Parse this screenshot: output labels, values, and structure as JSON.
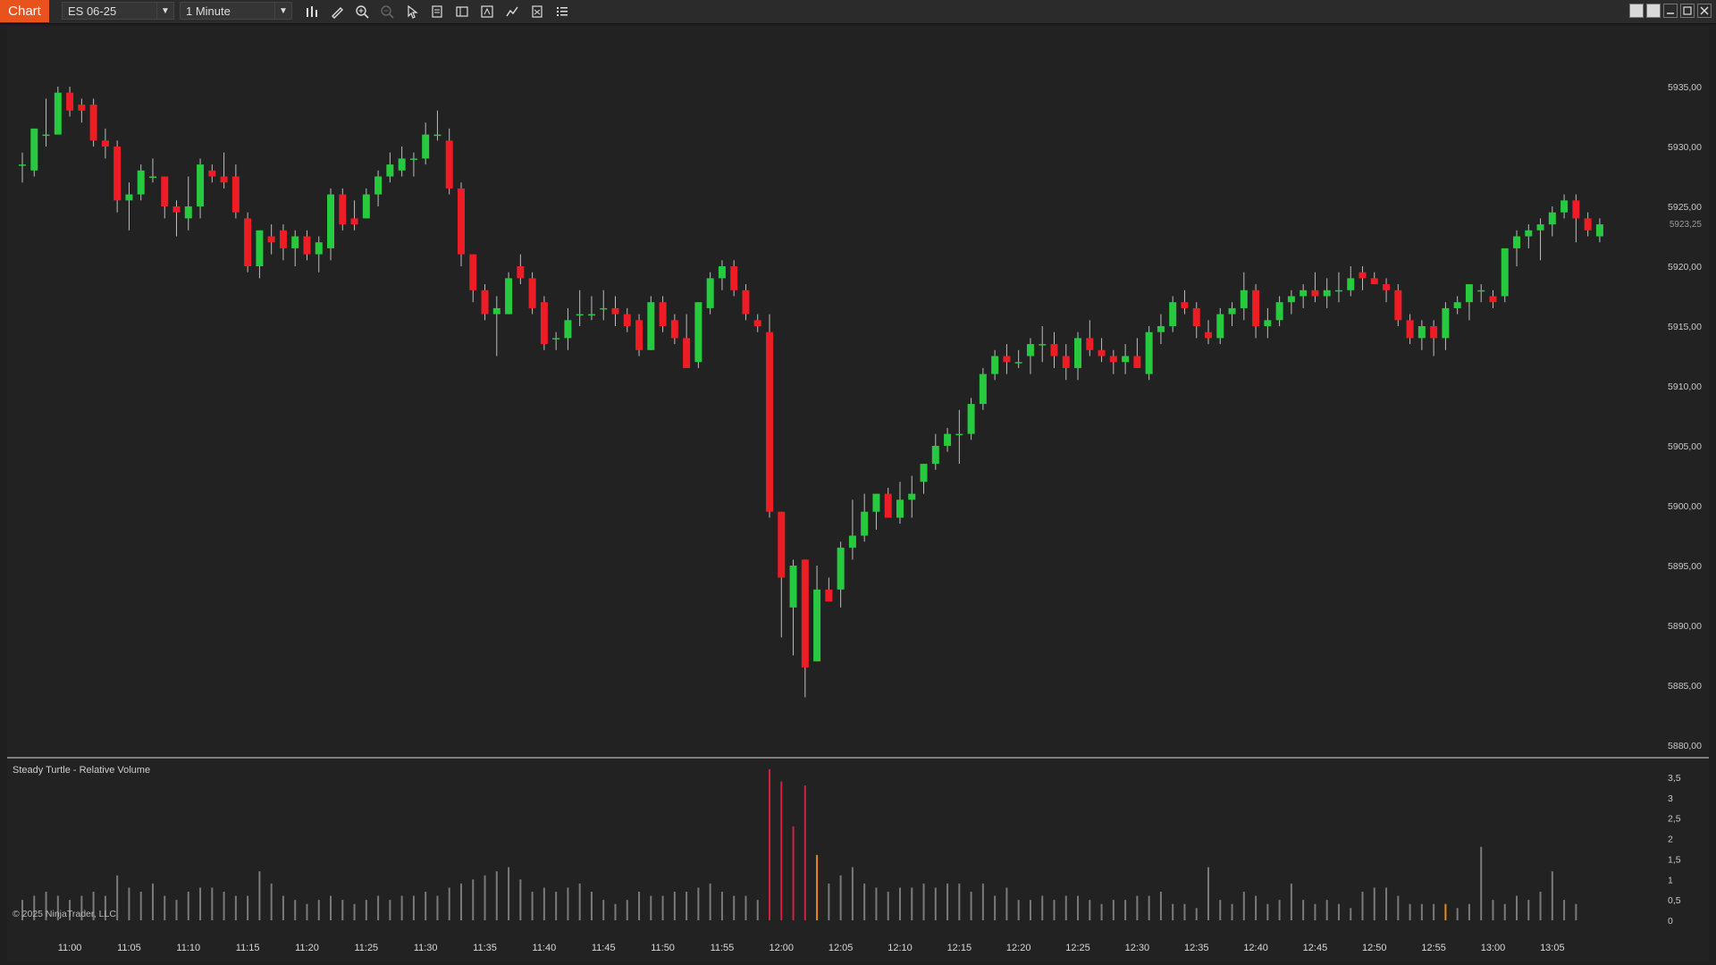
{
  "toolbar": {
    "app_tab": "Chart",
    "instrument": "ES 06-25",
    "interval": "1 Minute",
    "icons": [
      "bar-chart-icon",
      "pencil-icon",
      "zoom-in-icon",
      "zoom-out-icon",
      "pointer-icon",
      "properties-icon",
      "template-icon",
      "scale-icon",
      "strategy-icon",
      "calculator-icon",
      "list-icon"
    ]
  },
  "indicator_label": "Steady Turtle - Relative Volume",
  "copyright": "© 2025 NinjaTrader, LLC",
  "current_price": "5923,25",
  "colors": {
    "up": "#27c93f",
    "down": "#ee1c25",
    "wick": "#bdbdbd",
    "vol": "#7a7a7a",
    "vol_high": "#d12242",
    "vol_mid": "#e38b1d",
    "accent": "#e8531d"
  },
  "chart_data": [
    {
      "type": "candlestick",
      "instrument": "ES 06-25",
      "interval": "1 Minute",
      "y_tick_labels": [
        "5935,00",
        "5930,00",
        "5925,00",
        "5920,00",
        "5915,00",
        "5910,00",
        "5905,00",
        "5900,00",
        "5895,00",
        "5890,00",
        "5885,00",
        "5880,00"
      ],
      "y_range": [
        5880,
        5938
      ],
      "x_tick_labels": [
        "11:00",
        "11:05",
        "11:10",
        "11:15",
        "11:20",
        "11:25",
        "11:30",
        "11:35",
        "11:40",
        "11:45",
        "11:50",
        "11:55",
        "12:00",
        "12:05",
        "12:10",
        "12:15",
        "12:20",
        "12:25",
        "12:30",
        "12:35",
        "12:40",
        "12:45",
        "12:50",
        "12:55",
        "13:00",
        "13:05"
      ],
      "first_bar_time": "10:56",
      "columns": [
        "open",
        "high",
        "low",
        "close"
      ],
      "bars": [
        [
          5928.5,
          5929.5,
          5927.0,
          5928.5
        ],
        [
          5928.0,
          5931.5,
          5927.5,
          5931.5
        ],
        [
          5931.0,
          5934.0,
          5930.0,
          5931.0
        ],
        [
          5931.0,
          5935.0,
          5931.0,
          5934.5
        ],
        [
          5934.5,
          5935.0,
          5932.5,
          5933.0
        ],
        [
          5933.5,
          5934.0,
          5932.0,
          5933.0
        ],
        [
          5933.5,
          5934.0,
          5930.0,
          5930.5
        ],
        [
          5930.5,
          5931.5,
          5929.0,
          5930.0
        ],
        [
          5930.0,
          5930.5,
          5924.5,
          5925.5
        ],
        [
          5925.5,
          5927.0,
          5923.0,
          5926.0
        ],
        [
          5926.0,
          5928.5,
          5925.5,
          5928.0
        ],
        [
          5927.5,
          5929.0,
          5927.0,
          5927.5
        ],
        [
          5927.5,
          5927.5,
          5924.0,
          5925.0
        ],
        [
          5925.0,
          5925.5,
          5922.5,
          5924.5
        ],
        [
          5924.0,
          5927.5,
          5923.0,
          5925.0
        ],
        [
          5925.0,
          5929.0,
          5924.0,
          5928.5
        ],
        [
          5928.0,
          5928.5,
          5927.0,
          5927.5
        ],
        [
          5927.5,
          5929.5,
          5926.5,
          5927.0
        ],
        [
          5927.5,
          5928.5,
          5924.0,
          5924.5
        ],
        [
          5924.0,
          5924.5,
          5919.5,
          5920.0
        ],
        [
          5920.0,
          5923.0,
          5919.0,
          5923.0
        ],
        [
          5922.5,
          5923.5,
          5921.0,
          5922.0
        ],
        [
          5923.0,
          5923.5,
          5920.5,
          5921.5
        ],
        [
          5921.5,
          5923.0,
          5920.0,
          5922.5
        ],
        [
          5922.5,
          5923.0,
          5920.5,
          5921.0
        ],
        [
          5921.0,
          5922.5,
          5919.5,
          5922.0
        ],
        [
          5921.5,
          5926.5,
          5920.5,
          5926.0
        ],
        [
          5926.0,
          5926.5,
          5923.0,
          5923.5
        ],
        [
          5924.0,
          5925.5,
          5923.0,
          5923.5
        ],
        [
          5924.0,
          5926.5,
          5924.0,
          5926.0
        ],
        [
          5926.0,
          5928.0,
          5925.0,
          5927.5
        ],
        [
          5927.5,
          5929.5,
          5927.0,
          5928.5
        ],
        [
          5928.0,
          5930.0,
          5927.5,
          5929.0
        ],
        [
          5929.0,
          5929.5,
          5927.5,
          5929.0
        ],
        [
          5929.0,
          5932.0,
          5928.5,
          5931.0
        ],
        [
          5931.0,
          5933.0,
          5930.5,
          5931.0
        ],
        [
          5930.5,
          5931.5,
          5926.0,
          5926.5
        ],
        [
          5926.5,
          5927.0,
          5920.0,
          5921.0
        ],
        [
          5921.0,
          5921.0,
          5917.0,
          5918.0
        ],
        [
          5918.0,
          5918.5,
          5915.5,
          5916.0
        ],
        [
          5916.0,
          5917.5,
          5912.5,
          5916.5
        ],
        [
          5916.0,
          5919.5,
          5916.0,
          5919.0
        ],
        [
          5920.0,
          5921.0,
          5918.5,
          5919.0
        ],
        [
          5919.0,
          5919.5,
          5916.0,
          5916.5
        ],
        [
          5917.0,
          5917.5,
          5913.0,
          5913.5
        ],
        [
          5914.0,
          5914.5,
          5913.0,
          5914.0
        ],
        [
          5914.0,
          5916.5,
          5913.0,
          5915.5
        ],
        [
          5916.0,
          5918.0,
          5915.0,
          5916.0
        ],
        [
          5916.0,
          5917.5,
          5915.5,
          5916.0
        ],
        [
          5916.5,
          5918.0,
          5915.5,
          5916.5
        ],
        [
          5916.5,
          5917.5,
          5915.0,
          5916.0
        ],
        [
          5916.0,
          5916.5,
          5914.5,
          5915.0
        ],
        [
          5915.5,
          5916.0,
          5912.5,
          5913.0
        ],
        [
          5913.0,
          5917.5,
          5913.0,
          5917.0
        ],
        [
          5917.0,
          5917.5,
          5914.5,
          5915.0
        ],
        [
          5915.5,
          5916.0,
          5913.5,
          5914.0
        ],
        [
          5914.0,
          5916.0,
          5911.5,
          5911.5
        ],
        [
          5912.0,
          5917.0,
          5911.5,
          5917.0
        ],
        [
          5916.5,
          5919.5,
          5916.0,
          5919.0
        ],
        [
          5919.0,
          5920.5,
          5918.0,
          5920.0
        ],
        [
          5920.0,
          5920.5,
          5917.5,
          5918.0
        ],
        [
          5918.0,
          5918.5,
          5915.5,
          5916.0
        ],
        [
          5915.5,
          5916.0,
          5914.5,
          5915.0
        ],
        [
          5914.5,
          5916.0,
          5899.0,
          5899.5
        ],
        [
          5899.5,
          5899.5,
          5889.0,
          5894.0
        ],
        [
          5891.5,
          5895.5,
          5887.5,
          5895.0
        ],
        [
          5895.5,
          5895.5,
          5884.0,
          5886.5
        ],
        [
          5887.0,
          5895.0,
          5887.0,
          5893.0
        ],
        [
          5893.0,
          5894.0,
          5892.0,
          5892.0
        ],
        [
          5893.0,
          5897.0,
          5891.5,
          5896.5
        ],
        [
          5896.5,
          5900.5,
          5895.5,
          5897.5
        ],
        [
          5897.5,
          5901.0,
          5897.0,
          5899.5
        ],
        [
          5899.5,
          5900.5,
          5898.0,
          5901.0
        ],
        [
          5901.0,
          5901.5,
          5899.0,
          5899.0
        ],
        [
          5899.0,
          5902.0,
          5898.5,
          5900.5
        ],
        [
          5900.5,
          5902.5,
          5899.0,
          5901.0
        ],
        [
          5902.0,
          5903.5,
          5901.0,
          5903.5
        ],
        [
          5903.5,
          5906.0,
          5903.0,
          5905.0
        ],
        [
          5905.0,
          5906.5,
          5904.5,
          5906.0
        ],
        [
          5906.0,
          5908.0,
          5903.5,
          5906.0
        ],
        [
          5906.0,
          5909.0,
          5905.5,
          5908.5
        ],
        [
          5908.5,
          5911.5,
          5908.0,
          5911.0
        ],
        [
          5911.0,
          5913.0,
          5910.5,
          5912.5
        ],
        [
          5912.5,
          5913.5,
          5911.0,
          5912.0
        ],
        [
          5912.0,
          5913.0,
          5911.5,
          5912.0
        ],
        [
          5912.5,
          5914.0,
          5911.0,
          5913.5
        ],
        [
          5913.5,
          5915.0,
          5912.0,
          5913.5
        ],
        [
          5913.5,
          5914.5,
          5911.5,
          5912.5
        ],
        [
          5912.5,
          5913.5,
          5910.5,
          5911.5
        ],
        [
          5911.5,
          5914.5,
          5910.5,
          5914.0
        ],
        [
          5914.0,
          5915.5,
          5912.5,
          5913.0
        ],
        [
          5913.0,
          5914.0,
          5912.0,
          5912.5
        ],
        [
          5912.5,
          5913.0,
          5911.0,
          5912.0
        ],
        [
          5912.0,
          5913.5,
          5911.0,
          5912.5
        ],
        [
          5912.5,
          5914.0,
          5911.5,
          5911.5
        ],
        [
          5911.0,
          5915.0,
          5910.5,
          5914.5
        ],
        [
          5914.5,
          5916.0,
          5913.5,
          5915.0
        ],
        [
          5915.0,
          5917.5,
          5914.5,
          5917.0
        ],
        [
          5917.0,
          5918.0,
          5916.0,
          5916.5
        ],
        [
          5916.5,
          5917.0,
          5914.0,
          5915.0
        ],
        [
          5914.5,
          5915.5,
          5913.5,
          5914.0
        ],
        [
          5914.0,
          5916.5,
          5913.5,
          5916.0
        ],
        [
          5916.0,
          5917.0,
          5915.0,
          5916.5
        ],
        [
          5916.5,
          5919.5,
          5915.5,
          5918.0
        ],
        [
          5918.0,
          5918.5,
          5914.0,
          5915.0
        ],
        [
          5915.0,
          5916.5,
          5914.0,
          5915.5
        ],
        [
          5915.5,
          5917.5,
          5915.0,
          5917.0
        ],
        [
          5917.0,
          5918.0,
          5916.0,
          5917.5
        ],
        [
          5917.5,
          5918.5,
          5916.5,
          5918.0
        ],
        [
          5918.0,
          5919.5,
          5917.0,
          5917.5
        ],
        [
          5917.5,
          5919.0,
          5916.5,
          5918.0
        ],
        [
          5918.0,
          5919.5,
          5917.0,
          5918.0
        ],
        [
          5918.0,
          5920.0,
          5917.5,
          5919.0
        ],
        [
          5919.5,
          5920.0,
          5918.0,
          5919.0
        ],
        [
          5919.0,
          5919.5,
          5918.5,
          5918.5
        ],
        [
          5918.5,
          5919.0,
          5917.0,
          5918.0
        ],
        [
          5918.0,
          5918.5,
          5915.0,
          5915.5
        ],
        [
          5915.5,
          5916.0,
          5913.5,
          5914.0
        ],
        [
          5914.0,
          5915.5,
          5913.0,
          5915.0
        ],
        [
          5915.0,
          5915.5,
          5912.5,
          5914.0
        ],
        [
          5914.0,
          5917.0,
          5913.0,
          5916.5
        ],
        [
          5916.5,
          5917.5,
          5916.0,
          5917.0
        ],
        [
          5917.0,
          5918.5,
          5915.5,
          5918.5
        ],
        [
          5918.0,
          5918.5,
          5917.0,
          5918.0
        ],
        [
          5917.5,
          5918.0,
          5916.5,
          5917.0
        ],
        [
          5917.5,
          5921.5,
          5917.0,
          5921.5
        ],
        [
          5921.5,
          5923.0,
          5920.0,
          5922.5
        ],
        [
          5922.5,
          5923.5,
          5921.5,
          5923.0
        ],
        [
          5923.0,
          5924.0,
          5920.5,
          5923.5
        ],
        [
          5923.5,
          5925.0,
          5922.5,
          5924.5
        ],
        [
          5924.5,
          5926.0,
          5924.0,
          5925.5
        ],
        [
          5925.5,
          5926.0,
          5922.0,
          5924.0
        ],
        [
          5924.0,
          5924.5,
          5922.5,
          5923.0
        ],
        [
          5922.5,
          5924.0,
          5922.0,
          5923.5
        ]
      ]
    },
    {
      "type": "bar",
      "title": "Steady Turtle - Relative Volume",
      "y_tick_labels": [
        "3,5",
        "3",
        "2,5",
        "2",
        "1,5",
        "1",
        "0,5",
        "0"
      ],
      "y_range": [
        0,
        3.7
      ],
      "values": [
        0.5,
        0.6,
        0.7,
        0.6,
        0.5,
        0.6,
        0.7,
        0.6,
        1.1,
        0.8,
        0.7,
        0.9,
        0.6,
        0.5,
        0.7,
        0.8,
        0.8,
        0.7,
        0.6,
        0.6,
        1.2,
        0.9,
        0.6,
        0.5,
        0.4,
        0.5,
        0.6,
        0.5,
        0.4,
        0.5,
        0.6,
        0.5,
        0.6,
        0.6,
        0.7,
        0.6,
        0.8,
        0.9,
        1.0,
        1.1,
        1.2,
        1.3,
        1.0,
        0.7,
        0.8,
        0.7,
        0.8,
        0.9,
        0.7,
        0.5,
        0.4,
        0.5,
        0.7,
        0.6,
        0.6,
        0.7,
        0.7,
        0.8,
        0.9,
        0.7,
        0.6,
        0.6,
        0.5,
        3.7,
        3.4,
        2.3,
        3.3,
        1.6,
        0.9,
        1.1,
        1.3,
        0.9,
        0.8,
        0.7,
        0.8,
        0.8,
        0.9,
        0.8,
        0.9,
        0.9,
        0.7,
        0.9,
        0.6,
        0.8,
        0.5,
        0.5,
        0.6,
        0.5,
        0.6,
        0.6,
        0.5,
        0.4,
        0.5,
        0.5,
        0.6,
        0.6,
        0.7,
        0.4,
        0.4,
        0.3,
        1.3,
        0.5,
        0.4,
        0.7,
        0.6,
        0.4,
        0.5,
        0.9,
        0.5,
        0.4,
        0.5,
        0.4,
        0.3,
        0.7,
        0.8,
        0.8,
        0.6,
        0.4,
        0.4,
        0.4,
        0.4,
        0.3,
        0.4,
        1.8,
        0.5,
        0.4,
        0.6,
        0.5,
        0.7,
        1.2,
        0.5,
        0.4
      ],
      "highlight": {
        "63": "high",
        "64": "high",
        "65": "high",
        "66": "high",
        "67": "mid",
        "120": "mid"
      }
    }
  ]
}
